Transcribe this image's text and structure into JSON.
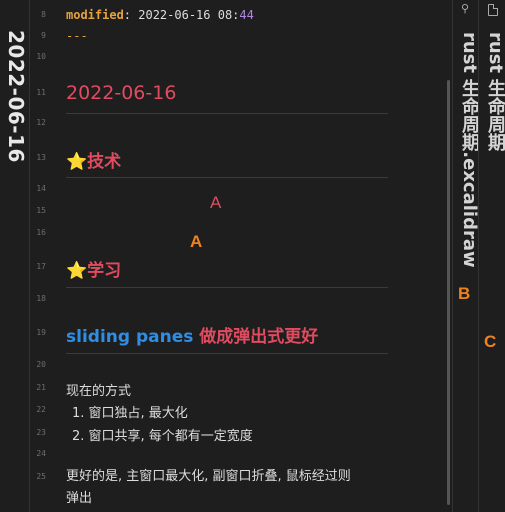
{
  "left_pane": {
    "title": "2022-06-16"
  },
  "editor": {
    "gutter": [
      "8",
      "9",
      "10",
      "11",
      "12",
      "13",
      "14",
      "15",
      "16",
      "17",
      "18",
      "19",
      "20",
      "21",
      "22",
      "23",
      "24",
      "25"
    ],
    "frontmatter": {
      "key": "modified",
      "sep": ": ",
      "value": "2022-06-16 08:",
      "value_tail": "44",
      "end": "---"
    },
    "date_heading": "2022-06-16",
    "section_tech": {
      "star": "⭐",
      "label": "技术"
    },
    "section_study": {
      "star": "⭐",
      "label": "学习"
    },
    "sliding_heading": {
      "blue": "sliding panes",
      "red": " 做成弹出式更好"
    },
    "para1": "现在的方式",
    "list": [
      "窗口独占, 最大化",
      "窗口共享, 每个都有一定宽度"
    ],
    "list_markers": [
      "1.",
      "2."
    ],
    "para2_line1": "更好的是, 主窗口最大化, 副窗口折叠, 鼠标经过则",
    "para2_line2": "弹出"
  },
  "annotations": {
    "a1": "A",
    "a2": "A",
    "b": "B",
    "c": "C"
  },
  "pane_b": {
    "title": "rust 生命周期.excalidraw",
    "icon": "link-icon"
  },
  "pane_c": {
    "title": "rust 生命周期",
    "icon": "file-icon"
  },
  "colors": {
    "bg": "#1e1e1e",
    "heading_red": "#e04b5f",
    "accent_orange": "#e5a340",
    "link_blue": "#2f8de4",
    "annot_red": "#e04b5f",
    "annot_orange": "#f0821e"
  }
}
